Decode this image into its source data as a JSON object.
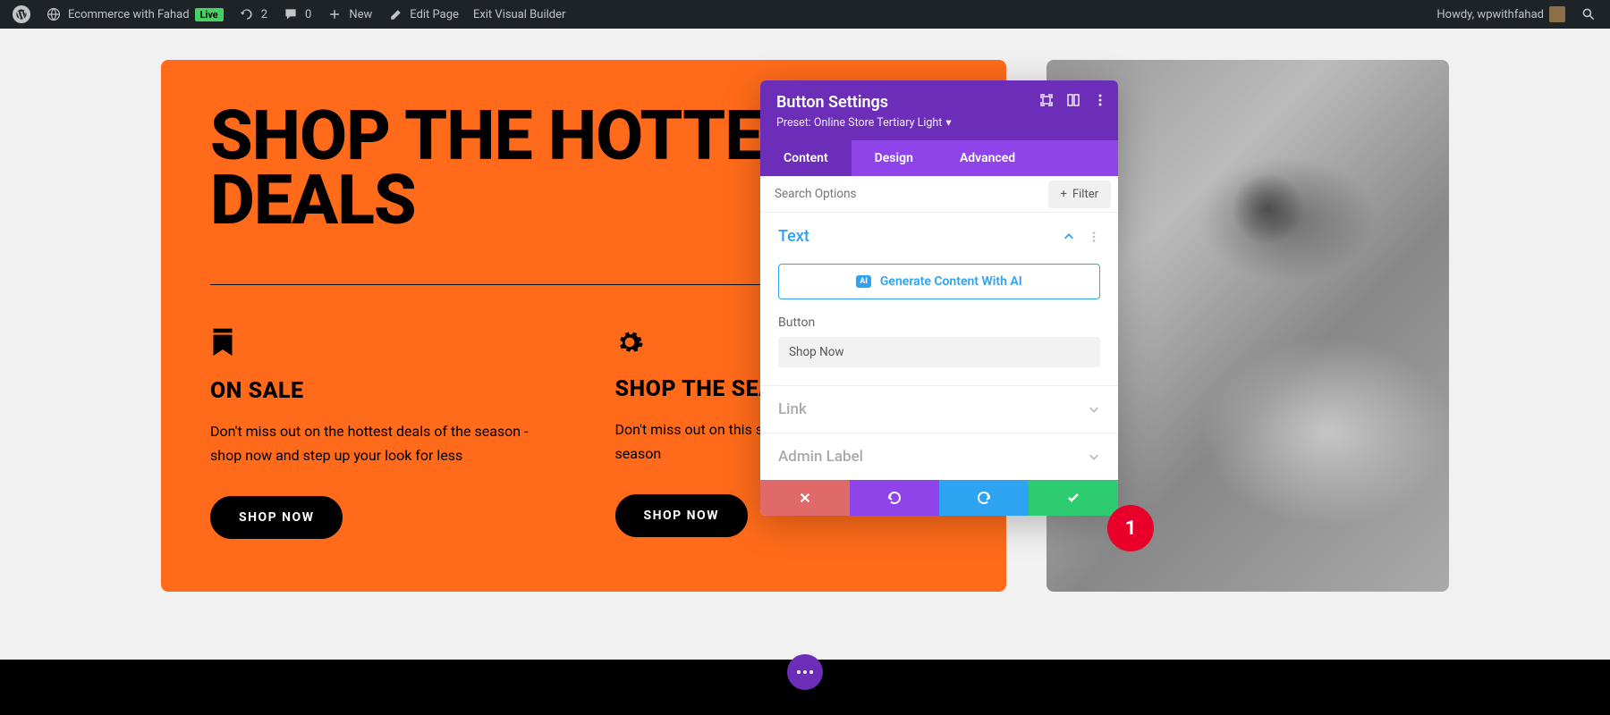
{
  "adminbar": {
    "site_name": "Ecommerce with Fahad",
    "live": "Live",
    "updates": "2",
    "comments": "0",
    "new": "New",
    "edit_page": "Edit Page",
    "exit_vb": "Exit Visual Builder",
    "howdy": "Howdy, wpwithfahad"
  },
  "hero": {
    "title": "SHOP THE HOTTEST DEALS",
    "blurbs": [
      {
        "heading": "ON SALE",
        "text": "Don't miss out on the hottest deals of the season - shop now and step up your look for less",
        "button": "shop now"
      },
      {
        "heading": "SHOP THE SEASON",
        "text": "Don't miss out on this seasons' hottest looks of the season",
        "button": "shop now"
      }
    ]
  },
  "panel": {
    "title": "Button Settings",
    "preset": "Preset: Online Store Tertiary Light",
    "tabs": {
      "content": "Content",
      "design": "Design",
      "advanced": "Advanced"
    },
    "search_placeholder": "Search Options",
    "filter": "Filter",
    "sections": {
      "text": "Text",
      "link": "Link",
      "admin_label": "Admin Label"
    },
    "ai_button": "Generate Content With AI",
    "ai_badge": "AI",
    "field_button_label": "Button",
    "field_button_value": "Shop Now"
  },
  "badge": "1"
}
